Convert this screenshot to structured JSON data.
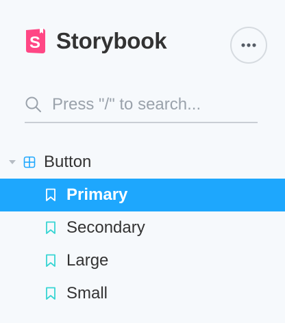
{
  "app": {
    "brand_name": "Storybook",
    "brand_color": "#ff4785",
    "menu_icon": "ellipsis-icon"
  },
  "search": {
    "placeholder": "Press \"/\" to search...",
    "value": "",
    "icon": "search-icon"
  },
  "tree": {
    "component": {
      "label": "Button",
      "icon": "component-grid-icon",
      "expanded": true
    },
    "stories": [
      {
        "label": "Primary",
        "selected": true,
        "icon": "bookmark-icon"
      },
      {
        "label": "Secondary",
        "selected": false,
        "icon": "bookmark-icon"
      },
      {
        "label": "Large",
        "selected": false,
        "icon": "bookmark-icon"
      },
      {
        "label": "Small",
        "selected": false,
        "icon": "bookmark-icon"
      }
    ]
  },
  "colors": {
    "selected_bg": "#1ea7fd",
    "story_icon": "#37d5d3",
    "component_icon": "#1ea7fd",
    "sidebar_bg": "#f6f9fc"
  }
}
